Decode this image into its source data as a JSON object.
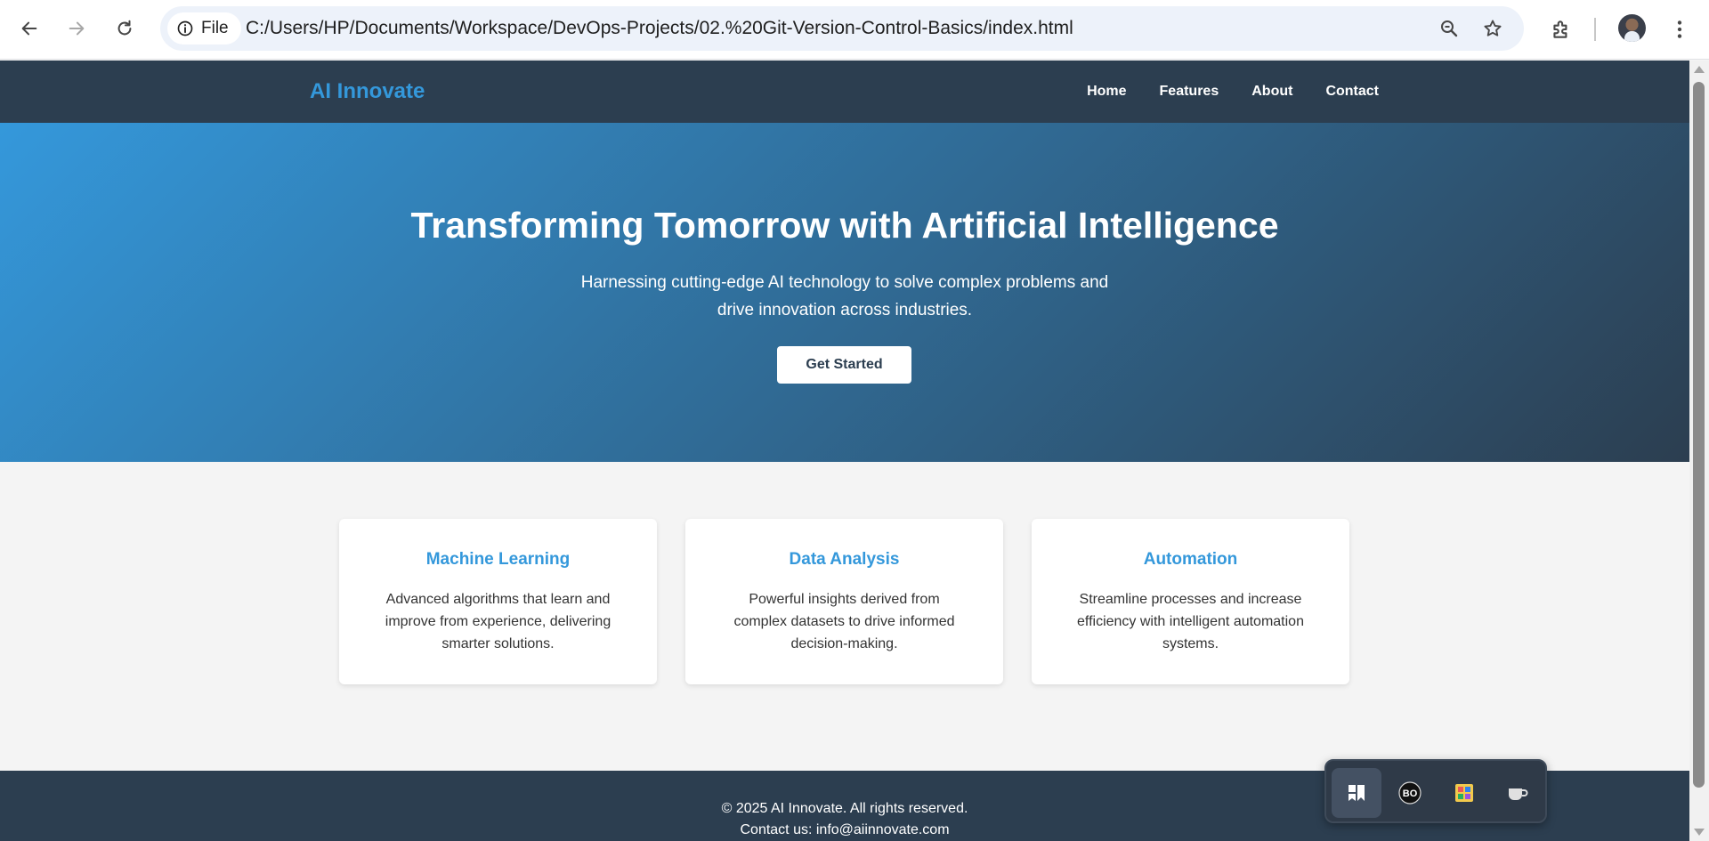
{
  "browser": {
    "site_chip_label": "File",
    "url": "C:/Users/HP/Documents/Workspace/DevOps-Projects/02.%20Git-Version-Control-Basics/index.html",
    "icons": [
      "back-arrow-icon",
      "forward-arrow-icon",
      "reload-icon",
      "info-icon",
      "zoom-icon",
      "bookmark-star-icon",
      "extensions-puzzle-icon",
      "profile-avatar",
      "kebab-menu-icon"
    ]
  },
  "site": {
    "logo": "AI Innovate",
    "nav": [
      "Home",
      "Features",
      "About",
      "Contact"
    ],
    "hero": {
      "title": "Transforming Tomorrow with Artificial Intelligence",
      "subtitle": "Harnessing cutting-edge AI technology to solve complex problems and drive innovation across industries.",
      "cta": "Get Started"
    },
    "features": [
      {
        "title": "Machine Learning",
        "text": "Advanced algorithms that learn and improve from experience, delivering smarter solutions."
      },
      {
        "title": "Data Analysis",
        "text": "Powerful insights derived from complex datasets to drive informed decision-making."
      },
      {
        "title": "Automation",
        "text": "Streamline processes and increase efficiency with intelligent automation systems."
      }
    ],
    "footer": {
      "copyright": "© 2025 AI Innovate. All rights reserved.",
      "contact": "Contact us: info@aiinnovate.com"
    }
  },
  "tray": {
    "items": [
      "bookmark-app-icon",
      "bo-app-icon",
      "colorful-grid-app-icon",
      "coffee-cup-icon"
    ]
  },
  "colors": {
    "header_bg": "#2c3e50",
    "accent": "#3498db",
    "page_bg": "#f4f4f4"
  }
}
